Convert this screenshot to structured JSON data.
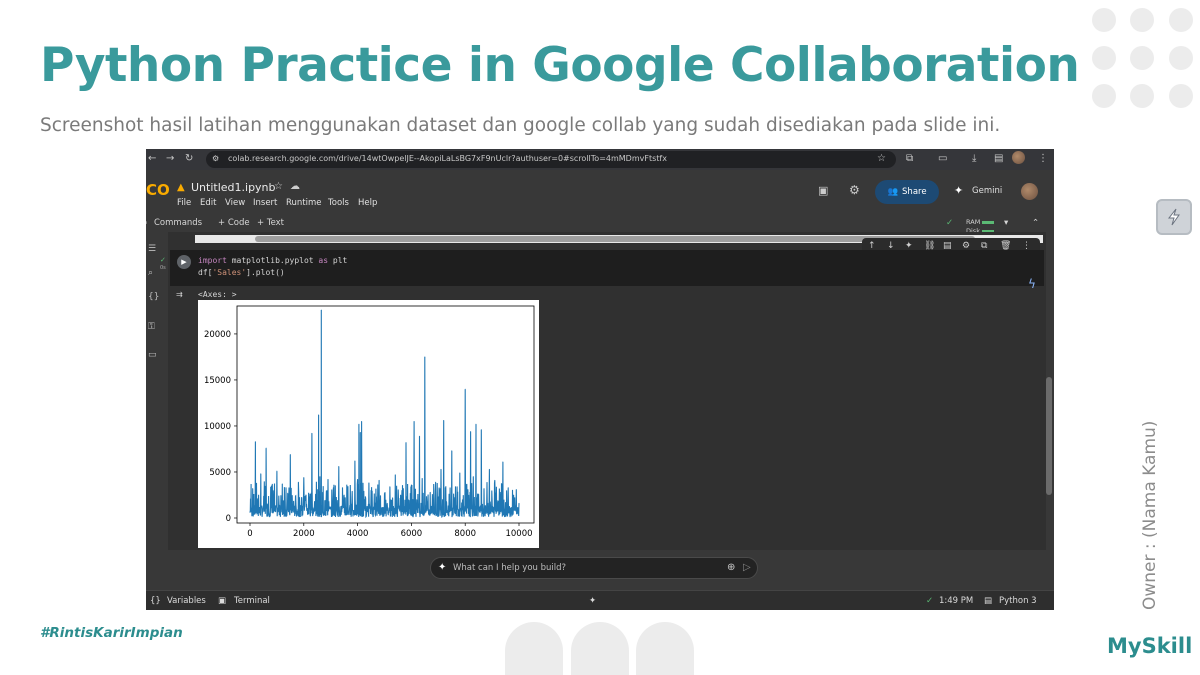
{
  "slide": {
    "title": "Python Practice in Google Collaboration",
    "subtitle": "Screenshot hasil latihan menggunakan dataset dan google collab yang sudah disediakan pada slide ini.",
    "owner": "Owner : (Nama Kamu)",
    "hashtag": "#RintisKarirImpian",
    "brand": "MySkill",
    "accent_color": "#3a9a9c"
  },
  "browser": {
    "url": "colab.research.google.com/drive/14wtOwpelJE--AkopiLaLsBG7xF9nUclr?authuser=0#scrollTo=4mMDmvFtstfx",
    "icons": [
      "back-icon",
      "forward-icon",
      "reload-icon",
      "site-info-icon",
      "bookmark-star-icon",
      "extensions-icon",
      "cast-icon",
      "download-icon",
      "profile-icon",
      "more-icon"
    ]
  },
  "colab": {
    "logo": "CO",
    "notebook_title": "Untitled1.ipynb",
    "menu": [
      "File",
      "Edit",
      "View",
      "Insert",
      "Runtime",
      "Tools",
      "Help"
    ],
    "share_label": "Share",
    "gemini_label": "Gemini",
    "commands_label": "Commands",
    "add_code_label": "+ Code",
    "add_text_label": "+ Text",
    "ram_label": "RAM",
    "disk_label": "Disk",
    "cell_status": "0s",
    "code_lines": {
      "line1_kw": "import",
      "line1_rest": " matplotlib.pyplot ",
      "line1_kw2": "as",
      "line1_end": " plt",
      "line2_start": "df[",
      "line2_str": "'Sales'",
      "line2_end": "].plot()"
    },
    "output_text": "<Axes: >",
    "ai_placeholder": "What can I help you build?",
    "status": {
      "variables": "Variables",
      "terminal": "Terminal",
      "time": "1:49 PM",
      "kernel": "Python 3"
    }
  },
  "chart_data": {
    "type": "line",
    "title": "",
    "xlabel": "",
    "ylabel": "",
    "xlim": [
      0,
      10000
    ],
    "ylim": [
      0,
      22600
    ],
    "x_ticks": [
      0,
      2000,
      4000,
      6000,
      8000,
      10000
    ],
    "y_ticks": [
      0,
      5000,
      10000,
      15000,
      20000
    ],
    "series_color": "#1f77b4",
    "grid": false,
    "series": [
      {
        "x": [
          0,
          100,
          200,
          300,
          400,
          500,
          600,
          700,
          800,
          900,
          1000,
          1100,
          1200,
          1300,
          1400,
          1500,
          1600,
          1700,
          1800,
          1900,
          2000,
          2100,
          2200,
          2300,
          2400,
          2500,
          2550,
          2600,
          2650,
          2700,
          2800,
          2900,
          3000,
          3100,
          3200,
          3300,
          3400,
          3500,
          3600,
          3700,
          3800,
          3900,
          4000,
          4050,
          4100,
          4150,
          4200,
          4300,
          4400,
          4500,
          4600,
          4700,
          4800,
          4900,
          5000,
          5100,
          5200,
          5300,
          5400,
          5500,
          5600,
          5700,
          5800,
          5900,
          6000,
          6100,
          6200,
          6300,
          6400,
          6500,
          6600,
          6700,
          6800,
          6900,
          7000,
          7100,
          7200,
          7300,
          7400,
          7500,
          7600,
          7700,
          7800,
          7900,
          8000,
          8100,
          8200,
          8300,
          8400,
          8500,
          8600,
          8700,
          8800,
          8900,
          9000,
          9100,
          9200,
          9300,
          9400,
          9500,
          9600,
          9700,
          9800,
          9900,
          10000
        ],
        "values": [
          600,
          3200,
          8300,
          2100,
          4800,
          1200,
          7600,
          900,
          3500,
          2200,
          5100,
          1400,
          3700,
          900,
          2700,
          6900,
          1100,
          2400,
          3900,
          800,
          4400,
          1500,
          2300,
          9200,
          1800,
          3100,
          11200,
          4500,
          22600,
          2800,
          1900,
          4200,
          1100,
          3300,
          2000,
          5600,
          1300,
          2500,
          3600,
          1000,
          2900,
          6200,
          4200,
          10200,
          9300,
          10500,
          3800,
          2100,
          1500,
          3000,
          1200,
          2300,
          4100,
          900,
          2700,
          1600,
          3400,
          2200,
          4700,
          1300,
          2500,
          3200,
          8200,
          1700,
          3600,
          10500,
          2000,
          8900,
          4300,
          17500,
          1500,
          2800,
          1100,
          3900,
          2300,
          5300,
          10600,
          1800,
          2600,
          7300,
          1200,
          3400,
          4900,
          2000,
          14000,
          3100,
          9400,
          4500,
          10200,
          2600,
          9600,
          3200,
          1500,
          5300,
          2000,
          4100,
          1300,
          2800,
          6100,
          1700,
          3300,
          1000,
          2500,
          3100,
          1600
        ]
      }
    ]
  }
}
